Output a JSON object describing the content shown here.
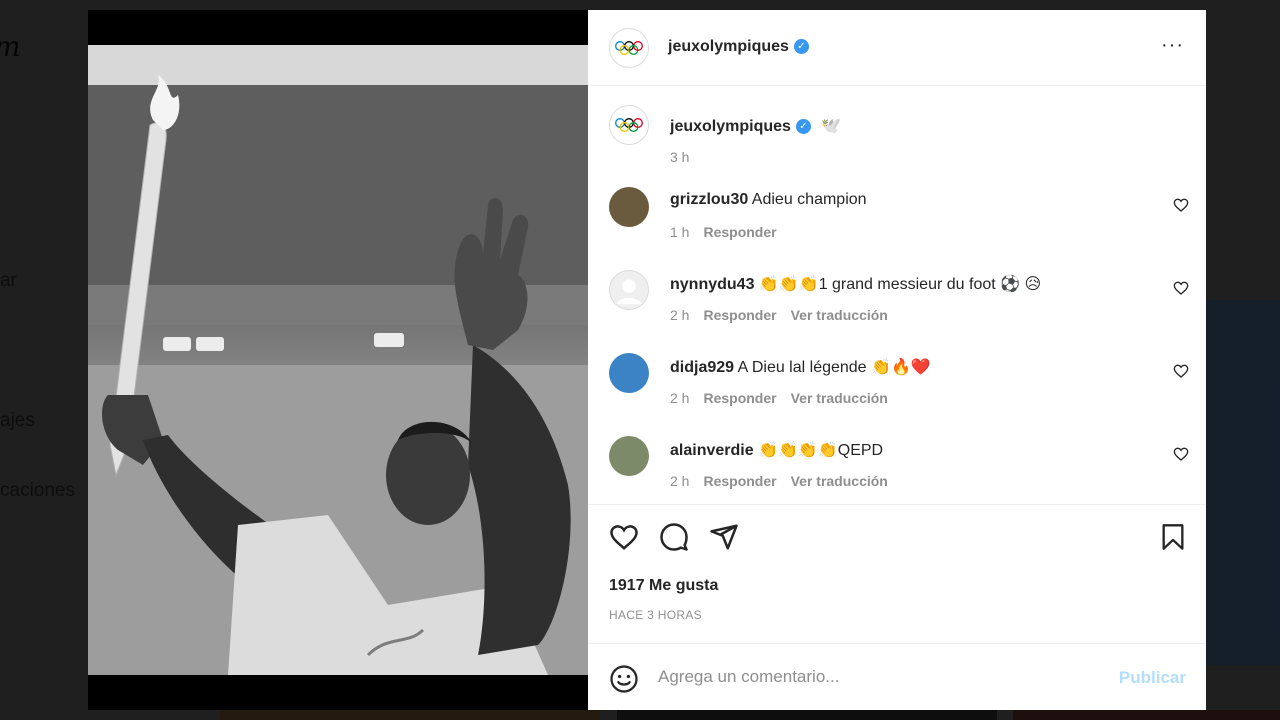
{
  "background": {
    "logo": "m",
    "nav_items": [
      "ar",
      "ajes",
      "caciones"
    ]
  },
  "post": {
    "author": "jeuxolympiques",
    "verified_symbol": "✓",
    "more_symbol": "···",
    "caption_text": "🕊️",
    "caption_time": "3 h",
    "likes": "1917 Me gusta",
    "posted_ago": "HACE 3 HORAS"
  },
  "comments": [
    {
      "user": "grizzlou30",
      "text": "Adieu champion",
      "time": "1 h",
      "reply": "Responder",
      "translate": "",
      "avatar_color": "#6b5b3e"
    },
    {
      "user": "nynnydu43",
      "text": "👏👏👏1 grand messieur du foot ⚽ 😥",
      "time": "2 h",
      "reply": "Responder",
      "translate": "Ver traducción",
      "avatar_color": "#dbdbdb"
    },
    {
      "user": "didja929",
      "text": "A Dieu lal légende 👏🔥❤️",
      "time": "2 h",
      "reply": "Responder",
      "translate": "Ver traducción",
      "avatar_color": "#3b83c4"
    },
    {
      "user": "alainverdie",
      "text": "👏👏👏👏QEPD",
      "time": "2 h",
      "reply": "Responder",
      "translate": "Ver traducción",
      "avatar_color": "#7d8a6a"
    }
  ],
  "composer": {
    "placeholder": "Agrega un comentario...",
    "publish_label": "Publicar"
  },
  "colors": {
    "accent": "#3897f0",
    "publish_disabled": "#b2dffc",
    "overlay": "rgba(0,0,0,0.65)"
  }
}
